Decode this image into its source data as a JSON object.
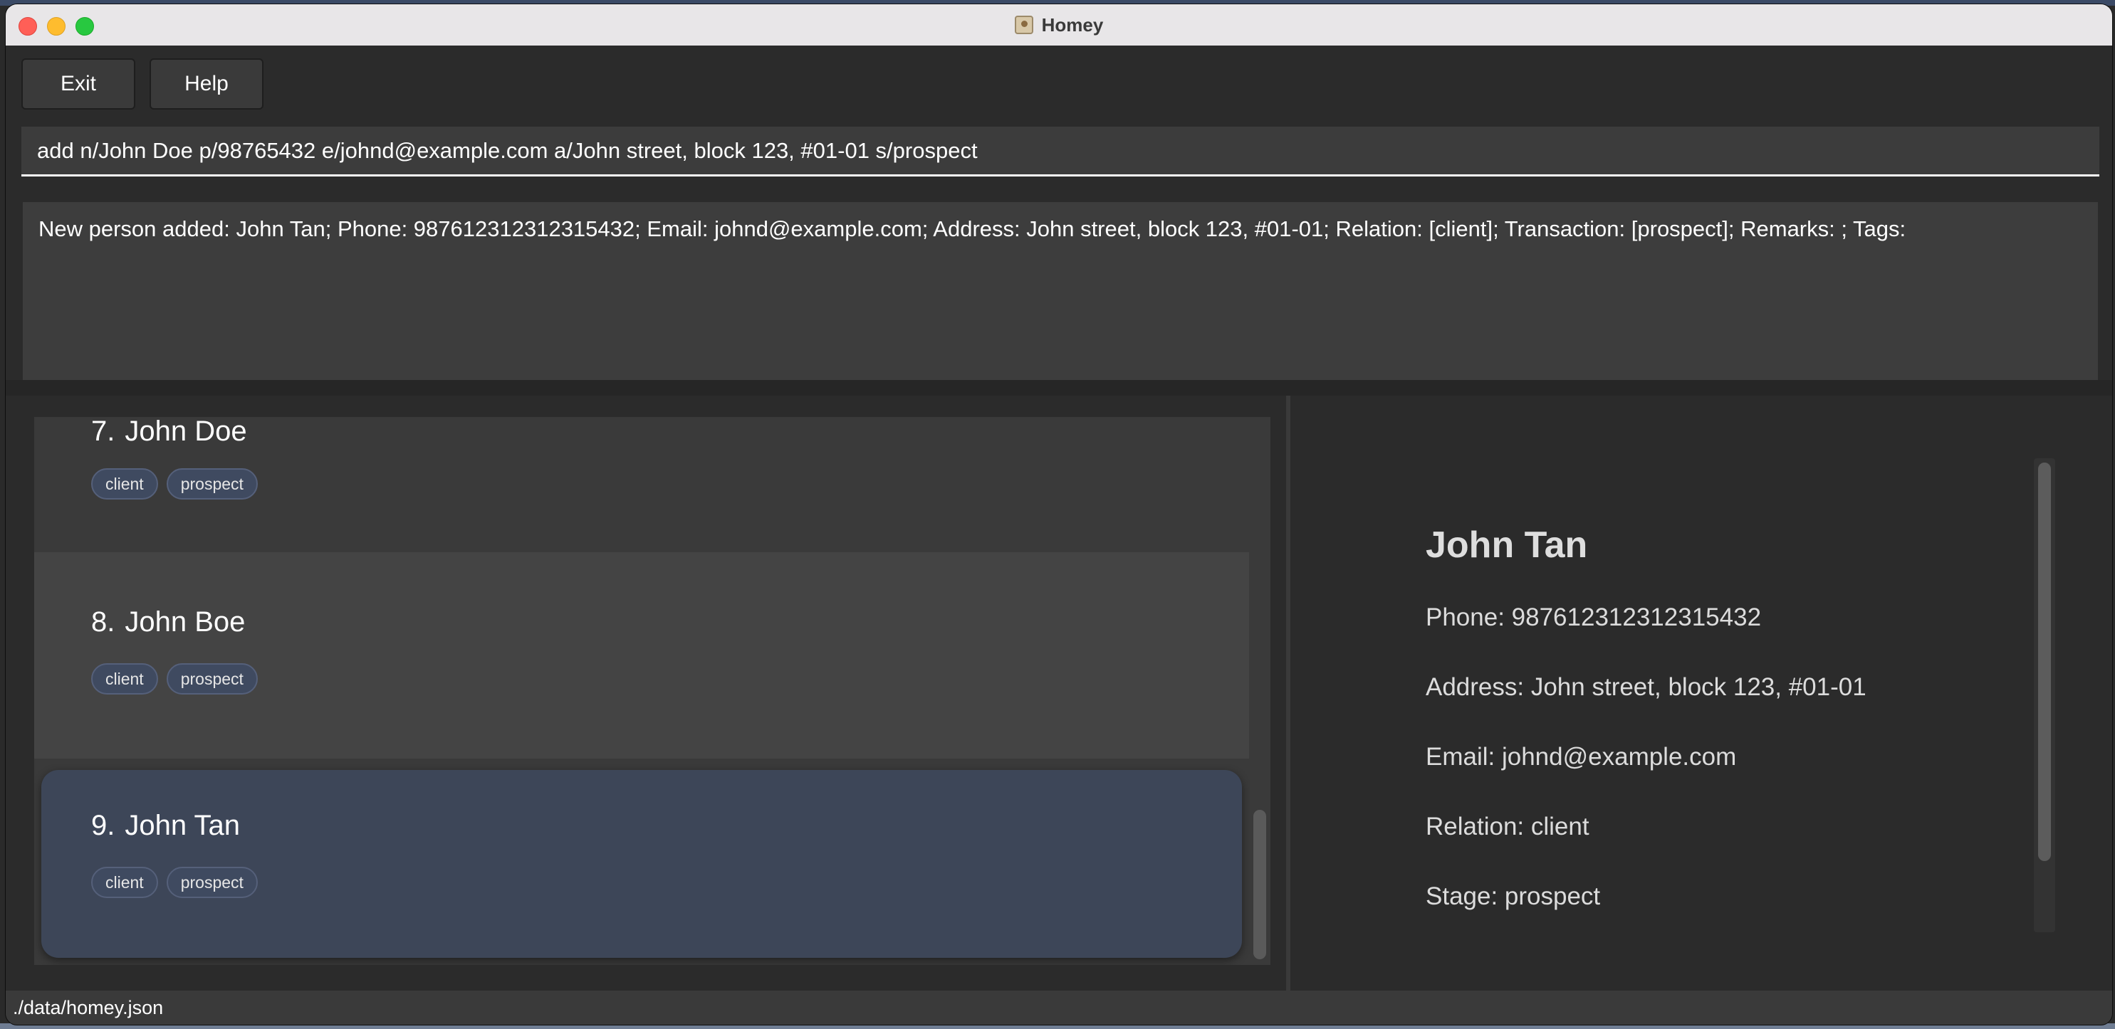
{
  "window": {
    "title": "Homey"
  },
  "menu": {
    "exit_label": "Exit",
    "help_label": "Help"
  },
  "command_box": {
    "value": "add n/John Doe p/98765432 e/johnd@example.com a/John street, block 123, #01-01 s/prospect"
  },
  "result_display": {
    "text": "New person added: John Tan; Phone: 987612312312315432; Email: johnd@example.com; Address: John street, block 123, #01-01; Relation: [client]; Transaction: [prospect]; Remarks: ; Tags:"
  },
  "person_list": [
    {
      "index": "7.",
      "name": "John Doe",
      "tags": [
        "client",
        "prospect"
      ]
    },
    {
      "index": "8.",
      "name": "John Boe",
      "tags": [
        "client",
        "prospect"
      ]
    },
    {
      "index": "9.",
      "name": "John Tan",
      "tags": [
        "client",
        "prospect"
      ],
      "selected": true
    }
  ],
  "detail": {
    "name": "John Tan",
    "phone": "Phone: 987612312312315432",
    "address": "Address: John street, block 123, #01-01",
    "email": "Email: johnd@example.com",
    "relation": "Relation: client",
    "stage": "Stage: prospect"
  },
  "status_bar": {
    "path": "./data/homey.json"
  },
  "colors": {
    "background": "#2b2b2b",
    "selected_card": "#3d4658",
    "tag_background": "#3f4a60",
    "traffic_close": "#ff5f57",
    "traffic_minimize": "#febc2e",
    "traffic_maximize": "#28c840"
  }
}
